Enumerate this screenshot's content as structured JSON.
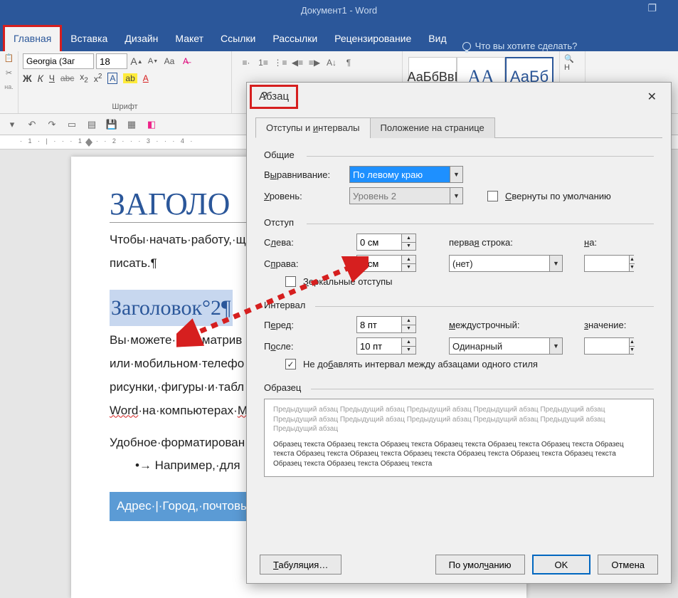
{
  "title": "Документ1 - Word",
  "tabs": [
    "Главная",
    "Вставка",
    "Дизайн",
    "Макет",
    "Ссылки",
    "Рассылки",
    "Рецензирование",
    "Вид"
  ],
  "tellMe": "Что вы хотите сделать?",
  "ribbon": {
    "fontName": "Georgia (Заг",
    "fontSize": "18",
    "fontGroupLabel": "Шрифт",
    "styleSamples": [
      "АаБбВвІ",
      "АА",
      "АаБб"
    ]
  },
  "findLabel": "Н",
  "doc": {
    "h1": "ЗАГОЛО",
    "p1": "Чтобы·начать·работу,·щ",
    "p2": "писать.¶",
    "h2": "Заголовок°2¶",
    "p3": "Вы·можете·просматрив",
    "p4": "или·мобильном·телефо",
    "p5": "рисунки,·фигуры·и·табл",
    "p6_a": "Word",
    "p6_b": "·на·компьютерах·",
    "p6_c": "M",
    "p7": "Удобное·форматирован",
    "p8": "•→ Например,·для",
    "addr": "Адрес·|·Город,·почтовы"
  },
  "dialog": {
    "title": "Абзац",
    "tab1": "Отступы и интервалы",
    "tab2": "Положение на странице",
    "grpGeneral": "Общие",
    "alignLabel": "Выравнивание:",
    "alignValue": "По левому краю",
    "levelLabel": "Уровень:",
    "levelValue": "Уровень 2",
    "collapseLabel": "Свернуты по умолчанию",
    "grpIndent": "Отступ",
    "leftLabel": "Слева:",
    "leftValue": "0 см",
    "rightLabel": "Справа:",
    "rightValue": "0 см",
    "firstLineLabel": "первая строка:",
    "firstLineValue": "(нет)",
    "byLabel": "на:",
    "mirrorLabel": "Зеркальные отступы",
    "grpInterval": "Интервал",
    "beforeLabel": "Перед:",
    "beforeValue": "8 пт",
    "afterLabel": "После:",
    "afterValue": "10 пт",
    "lineSpLabel": "междустрочный:",
    "lineSpValue": "Одинарный",
    "valueLabel": "значение:",
    "noAddLabel": "Не добавлять интервал между абзацами одного стиля",
    "grpPreview": "Образец",
    "prevTxt": "Предыдущий абзац Предыдущий абзац Предыдущий абзац Предыдущий абзац Предыдущий абзац Предыдущий абзац Предыдущий абзац Предыдущий абзац Предыдущий абзац Предыдущий абзац Предыдущий абзац",
    "sampleTxt": "Образец текста Образец текста Образец текста Образец текста Образец текста Образец текста Образец текста Образец текста Образец текста Образец текста Образец текста Образец текста Образец текста Образец текста Образец текста Образец текста",
    "btnTabs": "Табуляция…",
    "btnDefault": "По умолчанию",
    "btnOk": "OK",
    "btnCancel": "Отмена"
  }
}
